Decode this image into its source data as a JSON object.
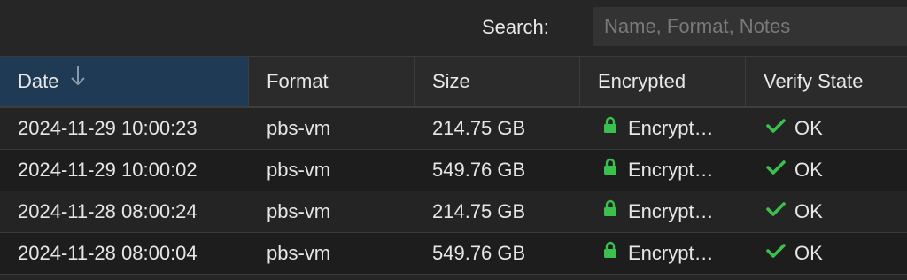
{
  "search": {
    "label": "Search:",
    "placeholder": "Name, Format, Notes",
    "value": ""
  },
  "columns": [
    {
      "label": "Date",
      "sorted": "desc"
    },
    {
      "label": "Format"
    },
    {
      "label": "Size"
    },
    {
      "label": "Encrypted"
    },
    {
      "label": "Verify State"
    }
  ],
  "rows": [
    {
      "date": "2024-11-29 10:00:23",
      "format": "pbs-vm",
      "size": "214.75 GB",
      "encrypted": "Encrypt…",
      "verify": "OK"
    },
    {
      "date": "2024-11-29 10:00:02",
      "format": "pbs-vm",
      "size": "549.76 GB",
      "encrypted": "Encrypt…",
      "verify": "OK"
    },
    {
      "date": "2024-11-28 08:00:24",
      "format": "pbs-vm",
      "size": "214.75 GB",
      "encrypted": "Encrypt…",
      "verify": "OK"
    },
    {
      "date": "2024-11-28 08:00:04",
      "format": "pbs-vm",
      "size": "549.76 GB",
      "encrypted": "Encrypt…",
      "verify": "OK"
    }
  ],
  "icons": {
    "sort": "arrow-down-icon",
    "encrypted": "lock-icon",
    "verify": "checkmark-icon"
  },
  "colors": {
    "accent_selected_header": "#1e3a55",
    "status_green": "#3bbf4e"
  }
}
